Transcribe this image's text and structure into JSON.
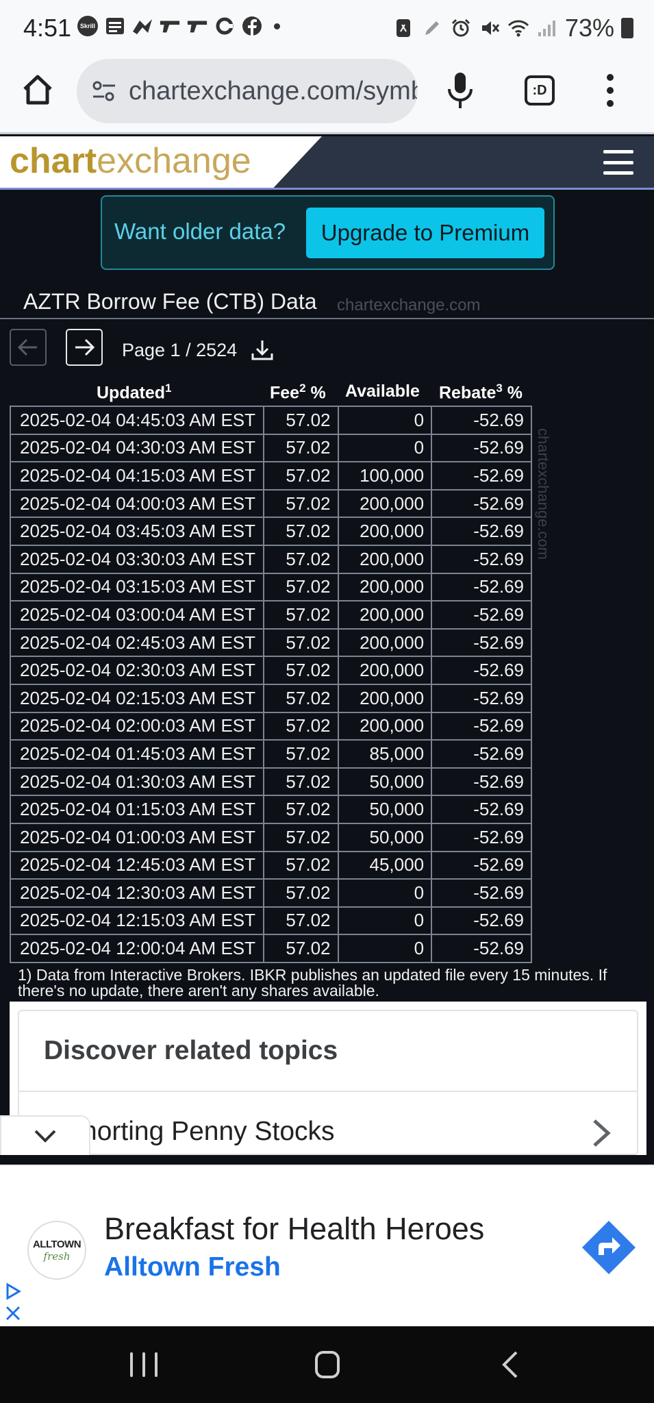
{
  "status_bar": {
    "time": "4:51",
    "battery": "73%",
    "left_icons": [
      "skrill-icon",
      "news-icon",
      "messenger-icon",
      "gun-icon",
      "gun-icon",
      "circle-c-icon",
      "facebook-icon"
    ],
    "right_icons": [
      "nfc-icon",
      "pen-icon",
      "alarm-icon",
      "mute-icon",
      "wifi-icon",
      "signal-icon"
    ]
  },
  "browser": {
    "url": "chartexchange.com/symbol/nasdaq-aztr/borrow-fee/",
    "tabs_label": ":D"
  },
  "site": {
    "logo_part1": "chart",
    "logo_part2": "exchange"
  },
  "upgrade_banner": {
    "text": "Want older data?",
    "button": "Upgrade to Premium"
  },
  "page": {
    "title": "AZTR Borrow Fee (CTB) Data",
    "watermark": "chartexchange.com"
  },
  "pagination": {
    "text": "Page 1 / 2524"
  },
  "table": {
    "headers": {
      "updated": "Updated",
      "updated_sup": "1",
      "fee": "Fee",
      "fee_sup": "2",
      "fee_unit": " %",
      "available": "Available",
      "rebate": "Rebate",
      "rebate_sup": "3",
      "rebate_unit": " %"
    },
    "rows": [
      [
        "2025-02-04 04:45:03 AM EST",
        "57.02",
        "0",
        "-52.69"
      ],
      [
        "2025-02-04 04:30:03 AM EST",
        "57.02",
        "0",
        "-52.69"
      ],
      [
        "2025-02-04 04:15:03 AM EST",
        "57.02",
        "100,000",
        "-52.69"
      ],
      [
        "2025-02-04 04:00:03 AM EST",
        "57.02",
        "200,000",
        "-52.69"
      ],
      [
        "2025-02-04 03:45:03 AM EST",
        "57.02",
        "200,000",
        "-52.69"
      ],
      [
        "2025-02-04 03:30:03 AM EST",
        "57.02",
        "200,000",
        "-52.69"
      ],
      [
        "2025-02-04 03:15:03 AM EST",
        "57.02",
        "200,000",
        "-52.69"
      ],
      [
        "2025-02-04 03:00:04 AM EST",
        "57.02",
        "200,000",
        "-52.69"
      ],
      [
        "2025-02-04 02:45:03 AM EST",
        "57.02",
        "200,000",
        "-52.69"
      ],
      [
        "2025-02-04 02:30:03 AM EST",
        "57.02",
        "200,000",
        "-52.69"
      ],
      [
        "2025-02-04 02:15:03 AM EST",
        "57.02",
        "200,000",
        "-52.69"
      ],
      [
        "2025-02-04 02:00:03 AM EST",
        "57.02",
        "200,000",
        "-52.69"
      ],
      [
        "2025-02-04 01:45:03 AM EST",
        "57.02",
        "85,000",
        "-52.69"
      ],
      [
        "2025-02-04 01:30:03 AM EST",
        "57.02",
        "50,000",
        "-52.69"
      ],
      [
        "2025-02-04 01:15:03 AM EST",
        "57.02",
        "50,000",
        "-52.69"
      ],
      [
        "2025-02-04 01:00:03 AM EST",
        "57.02",
        "50,000",
        "-52.69"
      ],
      [
        "2025-02-04 12:45:03 AM EST",
        "57.02",
        "45,000",
        "-52.69"
      ],
      [
        "2025-02-04 12:30:03 AM EST",
        "57.02",
        "0",
        "-52.69"
      ],
      [
        "2025-02-04 12:15:03 AM EST",
        "57.02",
        "0",
        "-52.69"
      ],
      [
        "2025-02-04 12:00:04 AM EST",
        "57.02",
        "0",
        "-52.69"
      ]
    ]
  },
  "footnote": "1) Data from Interactive Brokers. IBKR publishes an updated file every 15 minutes. If there's no update, there aren't any shares available.",
  "discover": {
    "title": "Discover related topics",
    "topic": "Shorting Penny Stocks"
  },
  "ad": {
    "logo_line1": "ALLTOWN",
    "logo_line2": "fresh",
    "title": "Breakfast for Health Heroes",
    "advertiser": "Alltown Fresh"
  },
  "colors": {
    "page_bg": "#0d1117",
    "accent_cyan": "#0cc4e8",
    "logo_gold": "#b8962e",
    "ad_blue": "#1a73e8"
  }
}
